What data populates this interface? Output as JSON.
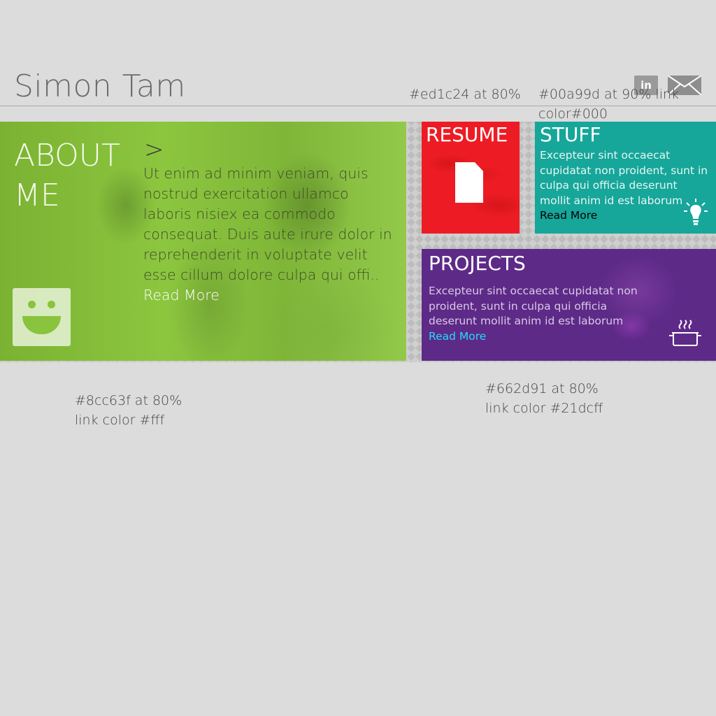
{
  "header": {
    "title": "Simon Tam",
    "social": [
      {
        "name": "linkedin",
        "label": "in",
        "icon": "linkedin-icon"
      },
      {
        "name": "mail",
        "label": "",
        "icon": "mail-icon"
      }
    ]
  },
  "annotations": {
    "red": "#ed1c24 at 80%",
    "teal": "#00a99d at 90% link color#000",
    "green_line1": "#8cc63f at 80%",
    "green_line2": "link color #fff",
    "purple_line1": "#662d91 at 80%",
    "purple_line2": "link color #21dcff"
  },
  "about": {
    "heading": "ABOUT ME",
    "arrow": ">",
    "body": "Ut enim ad minim veniam, quis nostrud exercitation ullamco laboris nisiex ea commodo consequat. Duis aute irure dolor in reprehenderit in voluptate velit esse cillum dolore culpa qui offi..",
    "link": "Read More",
    "icon": "smiley-icon"
  },
  "resume": {
    "title": "RESUME",
    "icon": "document-icon"
  },
  "stuff": {
    "title": "STUFF",
    "body": "Excepteur sint occaecat cupidatat non proident, sunt in culpa qui officia deserunt mollit anim id est laborum",
    "link": "Read More",
    "icon": "lightbulb-icon"
  },
  "projects": {
    "title": "PROJECTS",
    "body": "Excepteur sint occaecat cupidatat non proident, sunt in culpa qui officia deserunt mollit anim id est laborum",
    "link": "Read More",
    "icon": "cooking-pot-icon"
  },
  "colors": {
    "page_bg": "#dcdcdc",
    "about": "#8cc63f",
    "resume": "#ed1c24",
    "stuff": "#00a99d",
    "projects": "#662d91",
    "projects_link": "#21dcff"
  }
}
